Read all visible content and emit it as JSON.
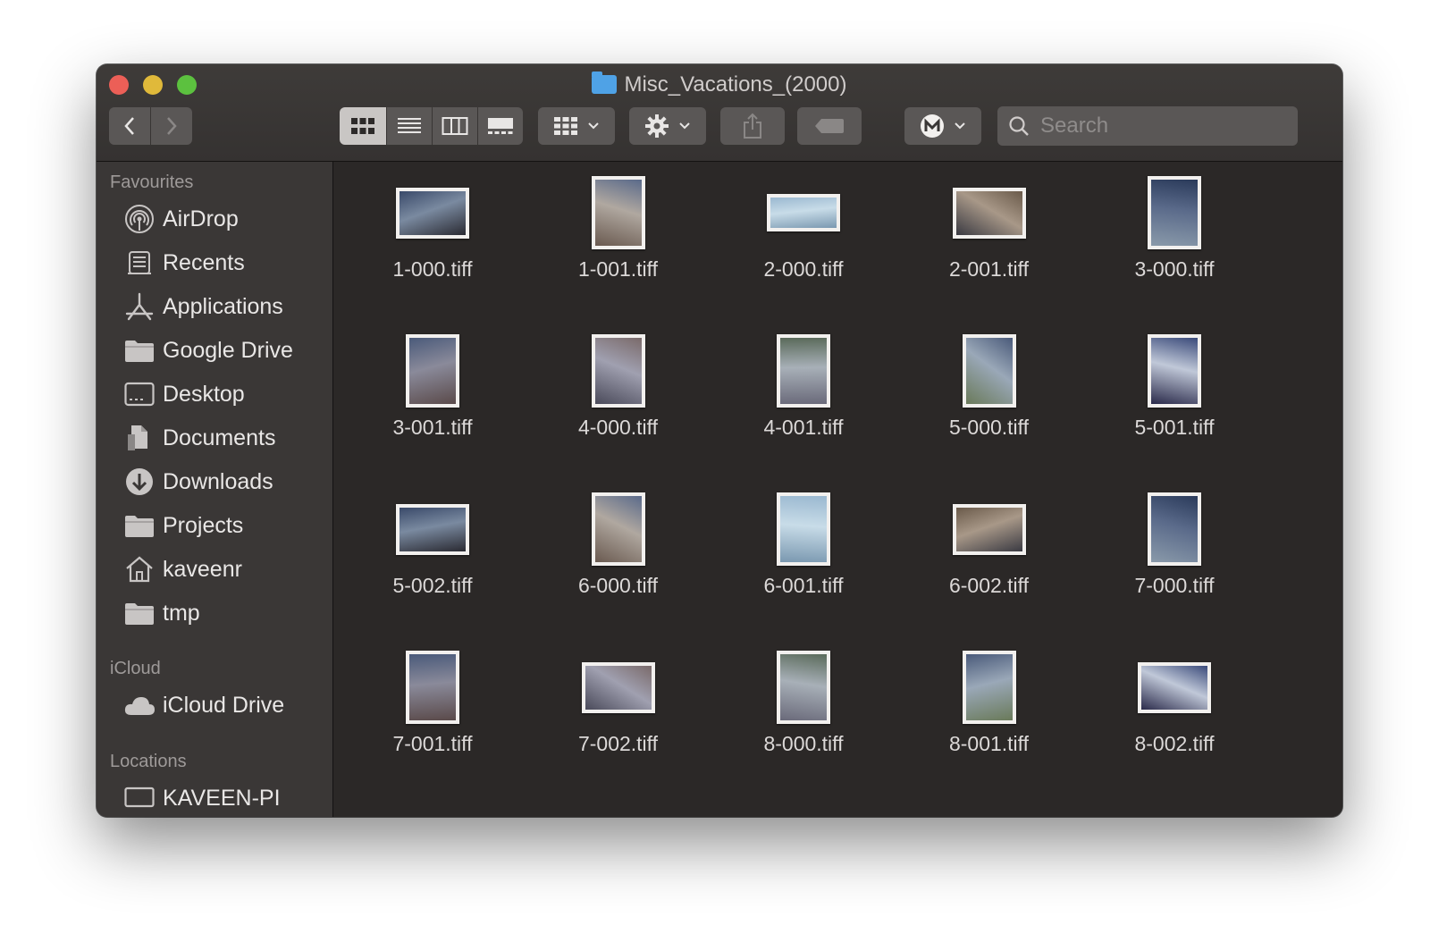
{
  "window": {
    "title": "Misc_Vacations_(2000)",
    "folder_icon": "folder-icon"
  },
  "toolbar": {
    "back_icon": "chevron-left-icon",
    "forward_icon": "chevron-right-icon",
    "view_modes": [
      "icon-view-icon",
      "list-view-icon",
      "column-view-icon",
      "gallery-view-icon"
    ],
    "active_view": "icon-view-icon",
    "group_icon": "grid-group-icon",
    "action_icon": "gear-icon",
    "share_icon": "share-icon",
    "tag_icon": "tag-icon",
    "extension_icon": "m-badge-icon",
    "search": {
      "placeholder": "Search",
      "value": ""
    }
  },
  "sidebar": {
    "favourites_label": "Favourites",
    "favourites": [
      {
        "label": "AirDrop",
        "icon": "airdrop-icon"
      },
      {
        "label": "Recents",
        "icon": "recents-icon"
      },
      {
        "label": "Applications",
        "icon": "applications-icon"
      },
      {
        "label": "Google Drive",
        "icon": "folder-icon"
      },
      {
        "label": "Desktop",
        "icon": "desktop-icon"
      },
      {
        "label": "Documents",
        "icon": "documents-icon"
      },
      {
        "label": "Downloads",
        "icon": "downloads-icon"
      },
      {
        "label": "Projects",
        "icon": "folder-icon"
      },
      {
        "label": "kaveenr",
        "icon": "home-icon"
      },
      {
        "label": "tmp",
        "icon": "folder-icon"
      }
    ],
    "icloud_label": "iCloud",
    "icloud": [
      {
        "label": "iCloud Drive",
        "icon": "cloud-icon"
      }
    ],
    "locations_label": "Locations",
    "locations": [
      {
        "label": "KAVEEN-PI",
        "icon": "computer-icon"
      }
    ]
  },
  "files": [
    {
      "name": "1-000.tiff",
      "orientation": "landscape"
    },
    {
      "name": "1-001.tiff",
      "orientation": "portrait"
    },
    {
      "name": "2-000.tiff",
      "orientation": "wide"
    },
    {
      "name": "2-001.tiff",
      "orientation": "landscape"
    },
    {
      "name": "3-000.tiff",
      "orientation": "portrait"
    },
    {
      "name": "3-001.tiff",
      "orientation": "portrait"
    },
    {
      "name": "4-000.tiff",
      "orientation": "portrait"
    },
    {
      "name": "4-001.tiff",
      "orientation": "portrait"
    },
    {
      "name": "5-000.tiff",
      "orientation": "portrait"
    },
    {
      "name": "5-001.tiff",
      "orientation": "portrait"
    },
    {
      "name": "5-002.tiff",
      "orientation": "landscape"
    },
    {
      "name": "6-000.tiff",
      "orientation": "portrait"
    },
    {
      "name": "6-001.tiff",
      "orientation": "portrait"
    },
    {
      "name": "6-002.tiff",
      "orientation": "landscape"
    },
    {
      "name": "7-000.tiff",
      "orientation": "portrait"
    },
    {
      "name": "7-001.tiff",
      "orientation": "portrait"
    },
    {
      "name": "7-002.tiff",
      "orientation": "landscape"
    },
    {
      "name": "8-000.tiff",
      "orientation": "portrait"
    },
    {
      "name": "8-001.tiff",
      "orientation": "portrait"
    },
    {
      "name": "8-002.tiff",
      "orientation": "landscape"
    }
  ],
  "colors": {
    "window_bg": "#2b2827",
    "sidebar_bg": "#3a3736",
    "close": "#ec5f57",
    "minimize": "#e0b93a",
    "maximize": "#5cc13f",
    "folder_accent": "#4fa2e6"
  }
}
